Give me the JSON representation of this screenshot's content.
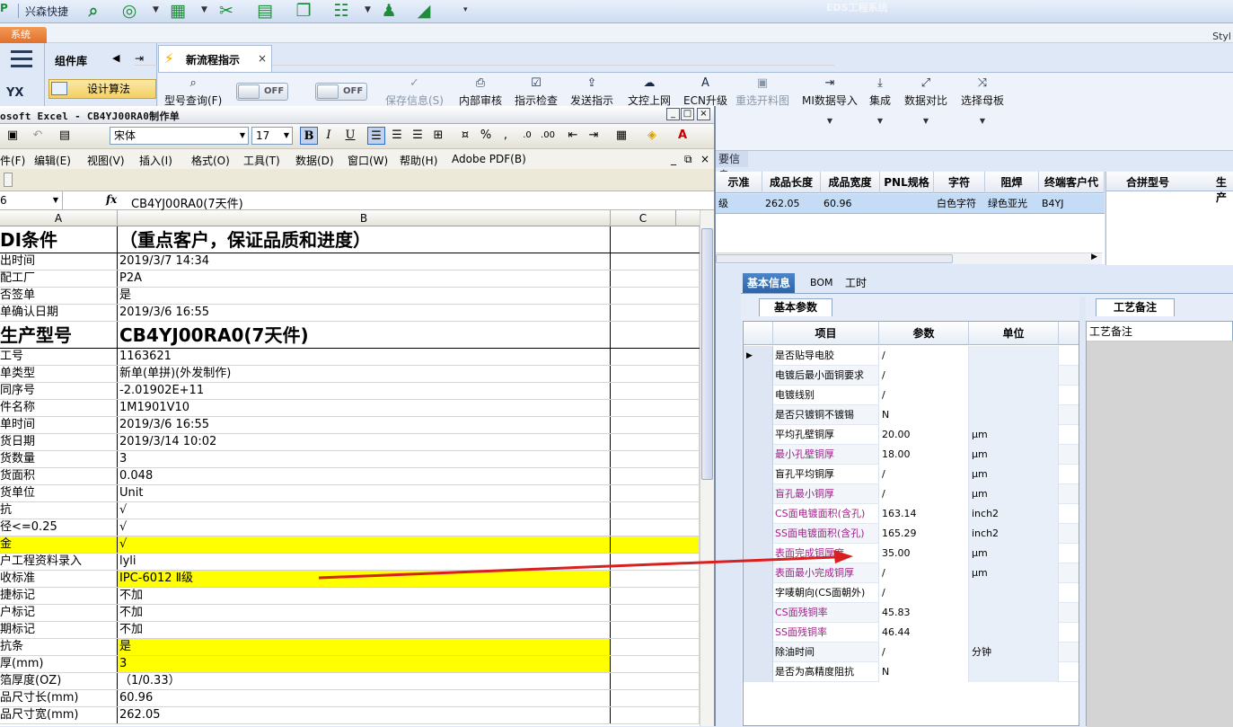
{
  "topbar": {
    "brand": "兴森快捷",
    "app_title": "EDS工程系统",
    "system_tab": "系统",
    "style_label": "Styl"
  },
  "nav": {
    "component_library": "组件库",
    "design_algorithm": "设计算法",
    "yx_label": "YX"
  },
  "doc_tab": {
    "label": "新流程指示"
  },
  "ribbon": {
    "model_query": "型号查询(F)",
    "toggle1": "OFF",
    "toggle2": "OFF",
    "save_info": "保存信息(S)",
    "internal_review": "内部审核",
    "instruction_check": "指示检查",
    "send_instruction": "发送指示",
    "doc_upload": "文控上网",
    "ecn_upgrade": "ECN升级",
    "reselect_chart": "重选开料图",
    "mi_import": "MI数据导入",
    "integrate": "集成",
    "data_compare": "数据对比",
    "select_master": "选择母板"
  },
  "info_tab": "要信息",
  "main_grid": {
    "headers": [
      "示准",
      "成品长度",
      "成品宽度",
      "PNL规格",
      "字符",
      "阻焊",
      "终端客户代"
    ],
    "row": [
      "级",
      "262.05",
      "60.96",
      "",
      "白色字符",
      "绿色亚光",
      "B4YJ"
    ],
    "right_headers": [
      "合拼型号",
      "生产"
    ]
  },
  "lower_tabs": [
    "基本信息",
    "BOM",
    "工时"
  ],
  "sub_tabs": {
    "basic_params": "基本参数",
    "process_notes": "工艺备注"
  },
  "param_grid": {
    "headers": [
      "项目",
      "参数",
      "单位"
    ],
    "rows": [
      {
        "name": "是否贴导电胶",
        "value": "/",
        "unit": ""
      },
      {
        "name": "电镀后最小面铜要求",
        "value": "/",
        "unit": ""
      },
      {
        "name": "电镀线别",
        "value": "/",
        "unit": ""
      },
      {
        "name": "是否只镀铜不镀锡",
        "value": "N",
        "unit": ""
      },
      {
        "name": "平均孔壁铜厚",
        "value": "20.00",
        "unit": "μm"
      },
      {
        "name": "最小孔壁铜厚",
        "value": "18.00",
        "unit": "μm"
      },
      {
        "name": "盲孔平均铜厚",
        "value": "/",
        "unit": "μm"
      },
      {
        "name": "盲孔最小铜厚",
        "value": "/",
        "unit": "μm"
      },
      {
        "name": "CS面电镀面积(含孔)",
        "value": "163.14",
        "unit": "inch2"
      },
      {
        "name": "SS面电镀面积(含孔)",
        "value": "165.29",
        "unit": "inch2"
      },
      {
        "name": "表面完成铜厚度",
        "value": "35.00",
        "unit": "μm"
      },
      {
        "name": "表面最小完成铜厚",
        "value": "/",
        "unit": "μm"
      },
      {
        "name": "字唛朝向(CS面朝外)",
        "value": "/",
        "unit": ""
      },
      {
        "name": "CS面残铜率",
        "value": "45.83",
        "unit": ""
      },
      {
        "name": "SS面残铜率",
        "value": "46.44",
        "unit": ""
      },
      {
        "name": "除油时间",
        "value": "/",
        "unit": "分钟"
      },
      {
        "name": "是否为高精度阻抗",
        "value": "N",
        "unit": ""
      }
    ],
    "magenta_rows": [
      5,
      7,
      8,
      9,
      10,
      11,
      13,
      14
    ]
  },
  "notes_header": "工艺备注",
  "excel": {
    "title": "osoft Excel - CB4YJ00RA0制作单",
    "font_name": "宋体",
    "font_size": "17",
    "menu": [
      "件(F)",
      "编辑(E)",
      "视图(V)",
      "插入(I)",
      "格式(O)",
      "工具(T)",
      "数据(D)",
      "窗口(W)",
      "帮助(H)",
      "Adobe PDF(B)"
    ],
    "name_box": "6",
    "formula": "CB4YJ00RA0(7天件)",
    "columns": [
      "A",
      "B",
      "C"
    ],
    "rows": [
      {
        "a": "DI条件",
        "b": "（重点客户，保证品质和进度）",
        "big": true
      },
      {
        "a": "出时间",
        "b": "2019/3/7 14:34"
      },
      {
        "a": "配工厂",
        "b": "P2A"
      },
      {
        "a": "否签单",
        "b": "是"
      },
      {
        "a": "单确认日期",
        "b": "2019/3/6 16:55"
      },
      {
        "a": "生产型号",
        "b": "CB4YJ00RA0(7天件)",
        "big": true
      },
      {
        "a": "工号",
        "b": "1163621"
      },
      {
        "a": "单类型",
        "b": "新单(单拼)(外发制作)"
      },
      {
        "a": "同序号",
        "b": "-2.01902E+11"
      },
      {
        "a": "件名称",
        "b": "1M1901V10"
      },
      {
        "a": "单时间",
        "b": "2019/3/6 16:55"
      },
      {
        "a": "货日期",
        "b": "2019/3/14 10:02"
      },
      {
        "a": "货数量",
        "b": "3"
      },
      {
        "a": "货面积",
        "b": "0.048"
      },
      {
        "a": "货单位",
        "b": "Unit"
      },
      {
        "a": "抗",
        "b": "√"
      },
      {
        "a": "径<=0.25",
        "b": "√"
      },
      {
        "a": "金",
        "b": "√",
        "yellow": true,
        "full": true
      },
      {
        "a": "户工程资料录入",
        "b": "lyli"
      },
      {
        "a": "收标准",
        "b": "IPC-6012 Ⅱ级",
        "yellow": true
      },
      {
        "a": "捷标记",
        "b": "不加"
      },
      {
        "a": "户标记",
        "b": "不加"
      },
      {
        "a": "期标记",
        "b": "不加"
      },
      {
        "a": "抗条",
        "b": "是",
        "yellow": true
      },
      {
        "a": "厚(mm)",
        "b": "3",
        "yellow": true
      },
      {
        "a": "箔厚度(OZ)",
        "b": "（1/0.33）"
      },
      {
        "a": "品尺寸长(mm)",
        "b": "60.96"
      },
      {
        "a": "品尺寸宽(mm)",
        "b": "262.05"
      }
    ]
  },
  "colors": {
    "magenta": "#a0208a",
    "highlight_yellow": "#ffff00",
    "selected_row": "#c5dcf7",
    "arrow": "#d92020"
  }
}
